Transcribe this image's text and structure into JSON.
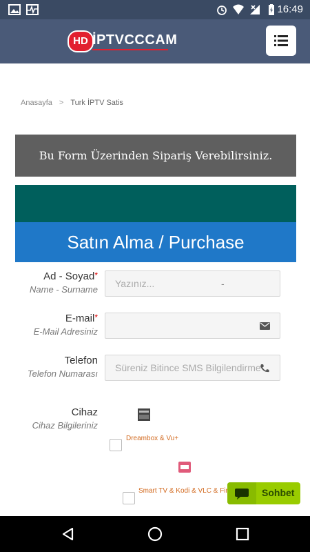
{
  "status_bar": {
    "time": "16:49"
  },
  "header": {
    "logo": {
      "badge": "HD",
      "brand": "İPTVCCCAM"
    },
    "menu_icon": "menu-icon"
  },
  "breadcrumb": {
    "home": "Anasayfa",
    "separator": ">",
    "current": "Turk İPTV Satis"
  },
  "form_banner": "Bu Form Üzerinden Sipariş Verebilirsiniz.",
  "purchase_title": "Satın Alma / Purchase",
  "fields": [
    {
      "label": "Ad - Soyad",
      "required": "*",
      "sublabel": "Name - Surname",
      "placeholder": "Yazınız...",
      "value": "-"
    },
    {
      "label": "E-mail",
      "required": "*",
      "sublabel": "E-Mail Adresiniz",
      "placeholder": "",
      "icon": "envelope-icon"
    },
    {
      "label": "Telefon",
      "sublabel": "Telefon Numarası",
      "placeholder": "Süreniz Bitince SMS Bilgilendirme",
      "icon": "phone-icon"
    },
    {
      "label": "Cihaz",
      "sublabel": "Cihaz Bilgileriniz"
    }
  ],
  "device_options": [
    {
      "label": "Dreambox & Vu+",
      "icon": "dreambox-icon"
    },
    {
      "label": "Smart TV & Kodi & VLC & Fire",
      "icon": "iptv-icon"
    }
  ],
  "chat": {
    "label": "Sohbet",
    "icon": "chat-bubble-icon",
    "color": "#99cc00"
  },
  "colors": {
    "header": "#4a5a78",
    "banner_grey": "#5f5f5f",
    "banner_teal": "#005f5c",
    "banner_blue": "#1f78c8",
    "required": "#dd0000"
  }
}
